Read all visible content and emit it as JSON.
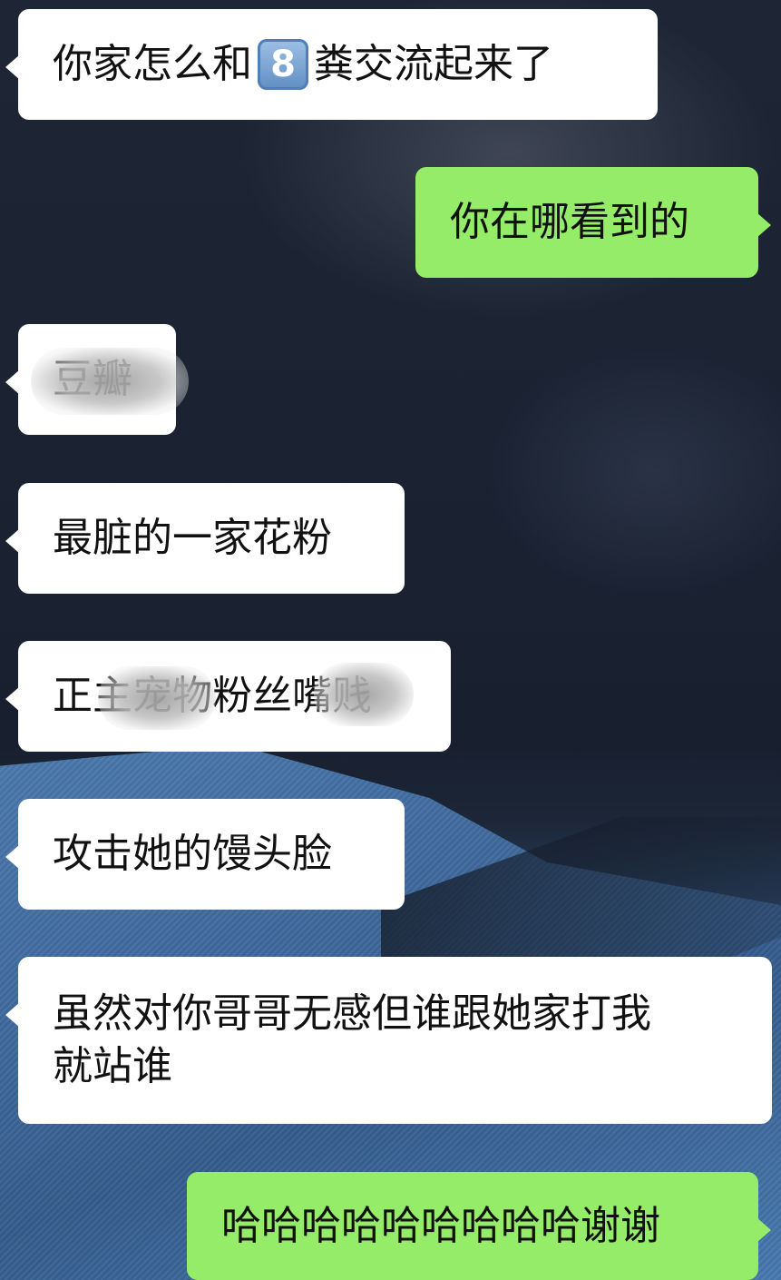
{
  "messages": [
    {
      "side": "in",
      "text_before": "你家怎么和",
      "emoji": "8",
      "text_after": "粪交流起来了"
    },
    {
      "side": "out",
      "text": "你在哪看到的"
    },
    {
      "side": "in",
      "text": "豆瓣"
    },
    {
      "side": "in",
      "text": "最脏的一家花粉"
    },
    {
      "side": "in",
      "text": "正主宠物粉丝嘴贱"
    },
    {
      "side": "in",
      "text": "攻击她的馒头脸"
    },
    {
      "side": "in",
      "line1": "虽然对你哥哥无感但谁跟她家打我",
      "line2": "就站谁"
    },
    {
      "side": "out",
      "text": "哈哈哈哈哈哈哈哈哈谢谢"
    }
  ],
  "colors": {
    "incoming_bubble": "#ffffff",
    "outgoing_bubble": "#95ec69",
    "text": "#111111"
  },
  "icons": {
    "keycap": "keycap-digit-eight-emoji"
  }
}
